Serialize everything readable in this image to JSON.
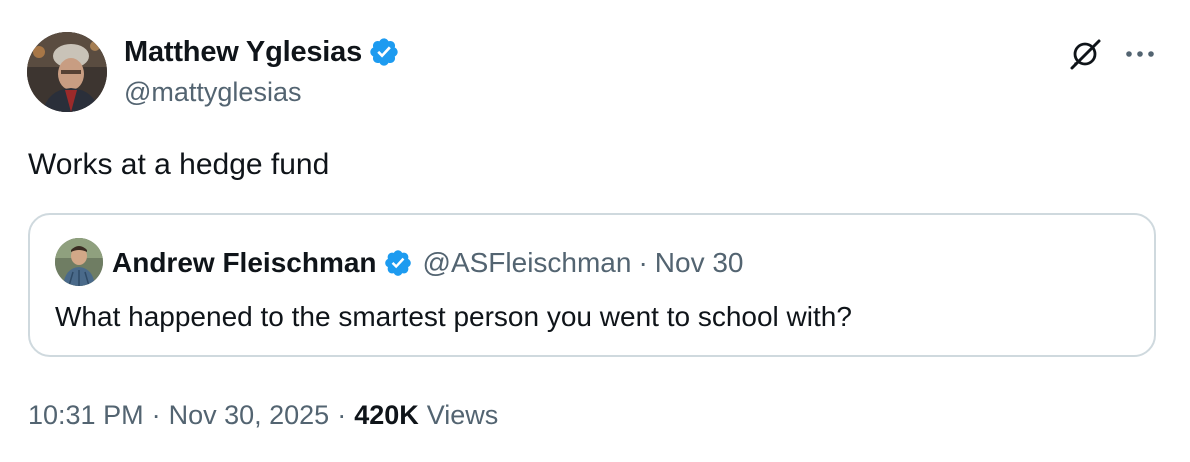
{
  "tweet": {
    "author": {
      "name": "Matthew Yglesias",
      "handle": "@mattyglesias",
      "verified": true
    },
    "text": "Works at a hedge fund",
    "time": "10:31 PM",
    "date": "Nov 30, 2025",
    "views_count": "420K",
    "views_label": "Views",
    "separator": "·"
  },
  "quote": {
    "author": {
      "name": "Andrew Fleischman",
      "handle": "@ASFleischman",
      "verified": true
    },
    "date": "Nov 30",
    "separator": "·",
    "text": "What happened to the smartest person you went to school with?"
  },
  "icons": {
    "verified": "verified-badge-icon",
    "grok": "grok-icon",
    "more": "more-options-icon"
  },
  "colors": {
    "verified_blue": "#1d9bf0",
    "secondary_text": "#536471",
    "primary_text": "#0f1419",
    "border": "#cfd9de"
  }
}
